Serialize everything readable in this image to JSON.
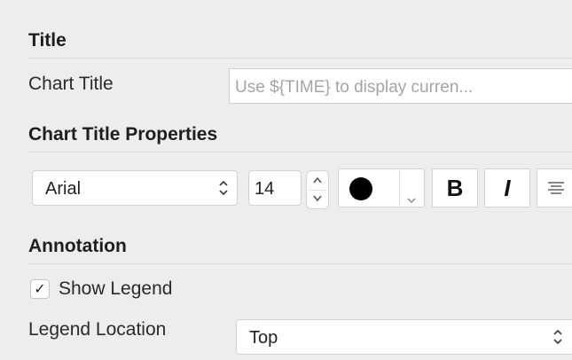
{
  "title_section": {
    "heading": "Title",
    "chart_title_label": "Chart Title",
    "chart_title_placeholder": "Use ${TIME} to display curren..."
  },
  "properties_section": {
    "heading": "Chart Title Properties",
    "font_family": "Arial",
    "font_size": "14",
    "color": "#000000",
    "bold_label": "B",
    "italic_label": "I",
    "align_icon": "align-center-icon"
  },
  "annotation_section": {
    "heading": "Annotation",
    "show_legend_label": "Show Legend",
    "show_legend_checked": true,
    "checkmark": "✓",
    "legend_location_label": "Legend Location",
    "legend_location_value": "Top"
  }
}
